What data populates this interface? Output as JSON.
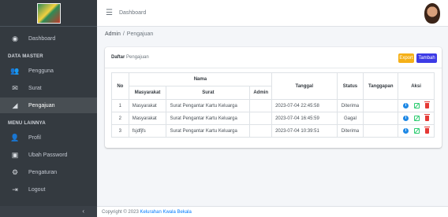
{
  "sidebar": {
    "items_top": [
      {
        "label": "Dashboard",
        "icon": "tachometer-icon"
      }
    ],
    "header1": "DATA MASTER",
    "items_master": [
      {
        "label": "Pengguna",
        "icon": "users-icon"
      },
      {
        "label": "Surat",
        "icon": "envelope-icon"
      },
      {
        "label": "Pengajuan",
        "icon": "paper-plane-icon"
      }
    ],
    "header2": "MENU LAINNYA",
    "items_other": [
      {
        "label": "Profil",
        "icon": "user-cog-icon"
      },
      {
        "label": "Ubah Password",
        "icon": "lock-icon"
      },
      {
        "label": "Pengaturan",
        "icon": "cogs-icon"
      },
      {
        "label": "Logout",
        "icon": "sign-out-icon"
      }
    ],
    "collapse": "‹"
  },
  "topbar": {
    "title": "Dashboard"
  },
  "breadcrumb": {
    "root": "Admin",
    "separator": "/",
    "current": "Pengajuan"
  },
  "card": {
    "title_bold": "Daftar",
    "title_rest": "Pengajuan",
    "export_label": "Export",
    "add_label": "Tambah"
  },
  "table": {
    "headers": {
      "no": "No",
      "nama": "Nama",
      "masyarakat": "Masyarakat",
      "surat": "Surat",
      "admin": "Admin",
      "tanggal": "Tanggal",
      "status": "Status",
      "tanggapan": "Tanggapan",
      "aksi": "Aksi"
    },
    "rows": [
      {
        "no": "1",
        "masyarakat": "Masyarakat",
        "surat": "Surat Pengantar Kartu Keluarga",
        "admin": "",
        "tanggal": "2023-07-04 22:45:58",
        "status": "Diterima",
        "tanggapan": ""
      },
      {
        "no": "2",
        "masyarakat": "Masyarakat",
        "surat": "Surat Pengantar Kartu Keluarga",
        "admin": "",
        "tanggal": "2023-07-04 16:45:59",
        "status": "Gagal",
        "tanggapan": ""
      },
      {
        "no": "3",
        "masyarakat": "fsjdfjfs",
        "surat": "Surat Pengantar Kartu Keluarga",
        "admin": "",
        "tanggal": "2023-07-04 10:39:51",
        "status": "Diterima",
        "tanggapan": ""
      }
    ]
  },
  "footer": {
    "prefix": "Copyright © 2023",
    "link": "Kelurahan Kwala Bekala"
  },
  "colors": {
    "sidebar": "#343a40",
    "export": "#f5b017",
    "add": "#3d3be6",
    "info": "#1e88e5",
    "edit": "#2ecc71",
    "delete": "#e53935",
    "link": "#007bff"
  }
}
